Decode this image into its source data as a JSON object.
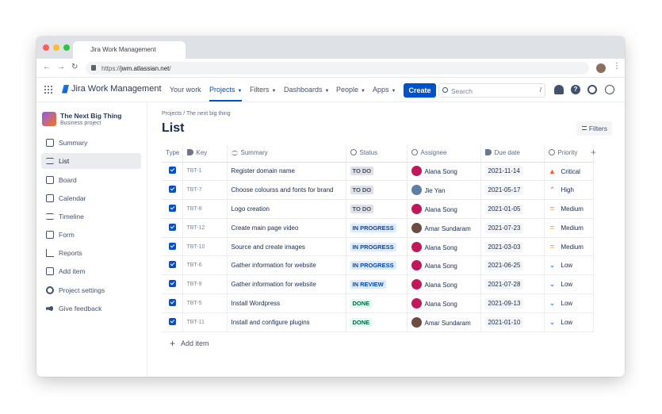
{
  "browser": {
    "tab_title": "Jira Work Management",
    "url_prefix": "https://",
    "url_host": "jwm.atlassian.net",
    "url_path": "/",
    "colors": {
      "close": "#ff5f57",
      "minimize": "#febc2e",
      "zoom": "#28c840"
    }
  },
  "topnav": {
    "brand": "Jira Work Management",
    "items": [
      "Your work",
      "Projects",
      "Filters",
      "Dashboards",
      "People",
      "Apps"
    ],
    "active_item": "Projects",
    "create_label": "Create",
    "search_placeholder": "Search",
    "search_shortcut": "/",
    "icons": [
      "notifications-icon",
      "help-icon",
      "settings-icon",
      "profile-icon"
    ]
  },
  "sidebar": {
    "project_name": "The Next Big Thing",
    "project_type": "Business project",
    "items": [
      {
        "label": "Summary",
        "icon": "summary-icon"
      },
      {
        "label": "List",
        "icon": "list-icon",
        "active": true
      },
      {
        "label": "Board",
        "icon": "board-icon"
      },
      {
        "label": "Calendar",
        "icon": "calendar-icon"
      },
      {
        "label": "Timeline",
        "icon": "timeline-icon"
      },
      {
        "label": "Form",
        "icon": "form-icon"
      },
      {
        "label": "Reports",
        "icon": "reports-icon"
      },
      {
        "label": "Add item",
        "icon": "add-icon"
      },
      {
        "label": "Project settings",
        "icon": "gear-icon"
      },
      {
        "label": "Give feedback",
        "icon": "megaphone-icon"
      }
    ]
  },
  "main": {
    "breadcrumb": "Projects / The next big thing",
    "title": "List",
    "filters_label": "Filters",
    "add_item_label": "Add item",
    "columns": [
      "Type",
      "Key",
      "Summary",
      "Status",
      "Assignee",
      "Due date",
      "Priority"
    ],
    "rows": [
      {
        "key": "TBT-1",
        "summary": "Register domain name",
        "status": "TO DO",
        "assignee": "Alana Song",
        "due": "2021-11-14",
        "priority": "Critical"
      },
      {
        "key": "TBT-7",
        "summary": "Choose colourss and fonts for brand",
        "status": "TO DO",
        "assignee": "Jie Yan",
        "due": "2021-05-17",
        "priority": "High"
      },
      {
        "key": "TBT-8",
        "summary": "Logo creation",
        "status": "TO DO",
        "assignee": "Alana Song",
        "due": "2021-01-05",
        "priority": "Medium"
      },
      {
        "key": "TBT-12",
        "summary": "Create main page video",
        "status": "IN PROGRESS",
        "assignee": "Amar Sundaram",
        "due": "2021-07-23",
        "priority": "Medium"
      },
      {
        "key": "TBT-10",
        "summary": "Source and create images",
        "status": "IN PROGRESS",
        "assignee": "Alana Song",
        "due": "2021-03-03",
        "priority": "Medium"
      },
      {
        "key": "TBT-6",
        "summary": "Gather information for website",
        "status": "IN PROGRESS",
        "assignee": "Alana Song",
        "due": "2021-06-25",
        "priority": "Low"
      },
      {
        "key": "TBT-9",
        "summary": "Gather information for website",
        "status": "IN REVIEW",
        "assignee": "Alana Song",
        "due": "2021-07-28",
        "priority": "Low"
      },
      {
        "key": "TBT-5",
        "summary": "Install Wordpress",
        "status": "DONE",
        "assignee": "Alana Song",
        "due": "2021-09-13",
        "priority": "Low"
      },
      {
        "key": "TBT-11",
        "summary": "Install and configure plugins",
        "status": "DONE",
        "assignee": "Amar Sundaram",
        "due": "2021-01-10",
        "priority": "Low"
      }
    ],
    "status_colors": {
      "TO DO": {
        "bg": "#dfe1e6",
        "fg": "#42526e"
      },
      "IN PROGRESS": {
        "bg": "#deebff",
        "fg": "#0747a6"
      },
      "IN REVIEW": {
        "bg": "#deebff",
        "fg": "#0747a6"
      },
      "DONE": {
        "bg": "#e3fcef",
        "fg": "#006644"
      }
    },
    "priority_colors": {
      "Critical": "#ff5630",
      "High": "#ff7452",
      "Medium": "#ffab00",
      "Low": "#2684ff"
    },
    "avatar_colors": {
      "Alana Song": "#c2185b",
      "Jie Yan": "#5d7fa3",
      "Amar Sundaram": "#6d4c41"
    }
  }
}
